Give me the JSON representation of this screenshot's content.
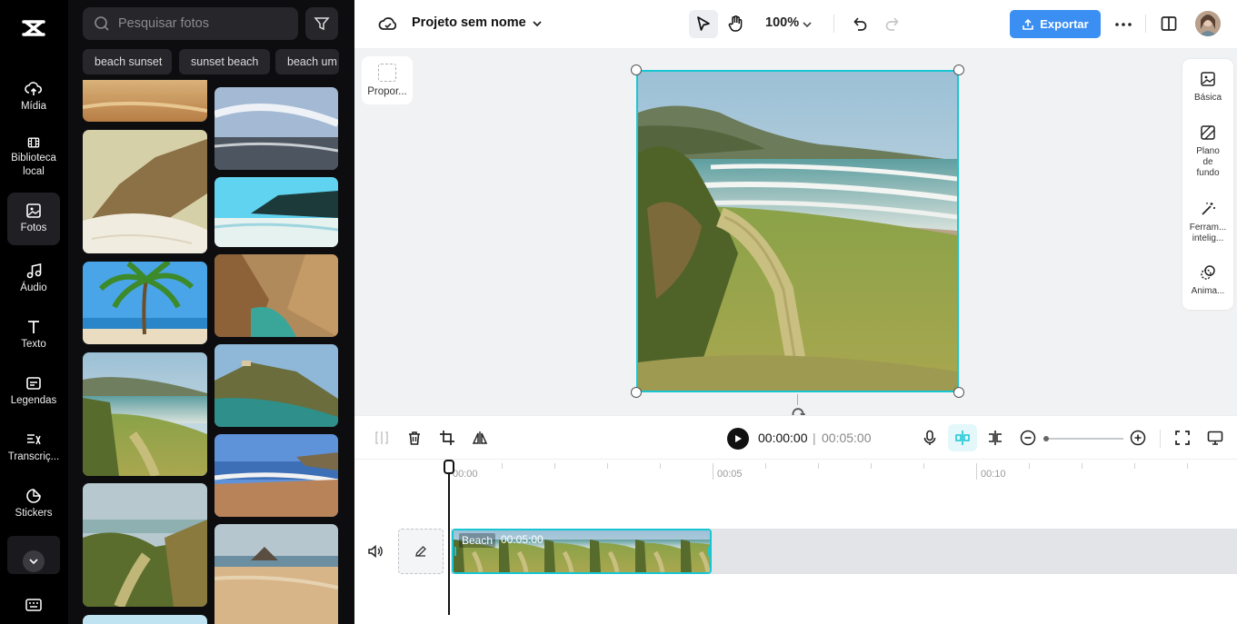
{
  "nav": {
    "items": [
      {
        "label": "Mídia",
        "icon": "cloud-upload-icon"
      },
      {
        "label": "Biblioteca local",
        "icon": "film-icon"
      },
      {
        "label": "Fotos",
        "icon": "image-icon"
      },
      {
        "label": "Áudio",
        "icon": "music-note-icon"
      },
      {
        "label": "Texto",
        "icon": "text-icon"
      },
      {
        "label": "Legendas",
        "icon": "captions-icon"
      },
      {
        "label": "Transcriç...",
        "icon": "transcript-icon"
      },
      {
        "label": "Stickers",
        "icon": "sticker-icon"
      }
    ],
    "active": "Fotos"
  },
  "panel": {
    "search_placeholder": "Pesquisar fotos",
    "chips": [
      "beach sunset",
      "sunset beach",
      "beach um"
    ]
  },
  "topbar": {
    "project_title": "Projeto sem nome",
    "zoom": "100%",
    "export_label": "Exportar"
  },
  "canvas": {
    "aspect_label": "Propor..."
  },
  "right_panel": {
    "items": [
      "Básica",
      "Plano de fundo",
      "Ferram... intelig...",
      "Anima..."
    ]
  },
  "toolbar": {
    "current_time": "00:00:00",
    "separator": "|",
    "duration": "00:05:00"
  },
  "timeline": {
    "ruler": [
      "00:00",
      "00:05",
      "00:10"
    ],
    "clip_name": "Beach",
    "clip_duration": "00:05:00"
  },
  "colors": {
    "accent": "#18c6d3",
    "export": "#3b8ef2",
    "nav_bg": "#000000"
  }
}
